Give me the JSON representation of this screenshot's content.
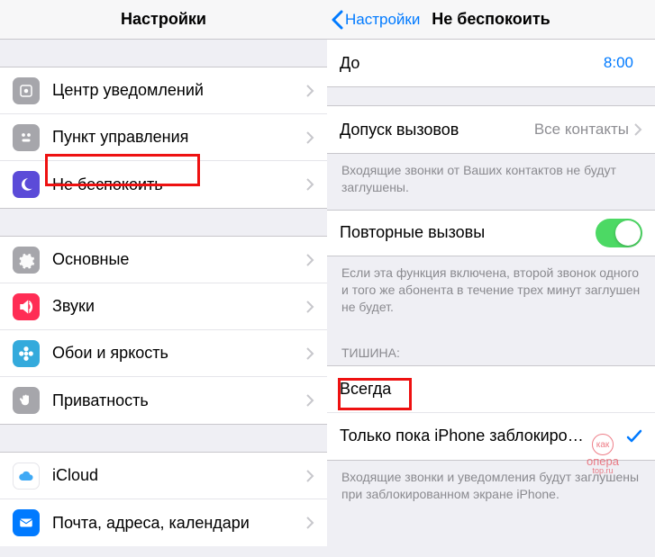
{
  "left": {
    "title": "Настройки",
    "group1": [
      {
        "label": "Центр уведомлений"
      },
      {
        "label": "Пункт управления"
      },
      {
        "label": "Не беспокоить"
      }
    ],
    "group2": [
      {
        "label": "Основные"
      },
      {
        "label": "Звуки"
      },
      {
        "label": "Обои и яркость"
      },
      {
        "label": "Приватность"
      }
    ],
    "group3": [
      {
        "label": "iCloud"
      },
      {
        "label": "Почта, адреса, календари"
      }
    ]
  },
  "right": {
    "back": "Настройки",
    "title": "Не беспокоить",
    "to_label": "До",
    "to_value": "8:00",
    "allow_calls_label": "Допуск вызовов",
    "allow_calls_value": "Все контакты",
    "allow_calls_footer": "Входящие звонки от Ваших контактов не будут заглушены.",
    "repeated_label": "Повторные вызовы",
    "repeated_footer": "Если эта функция включена, второй звонок одного и того же абонента в течение трех минут заглушен не будет.",
    "silence_header": "ТИШИНА:",
    "silence_opts": [
      "Всегда",
      "Только пока iPhone заблокиро…"
    ],
    "silence_footer": "Входящие звонки и уведомления будут заглушены при заблокированном экране iPhone."
  },
  "watermark": {
    "a": "как",
    "b": "опера",
    "c": "top.ru"
  }
}
